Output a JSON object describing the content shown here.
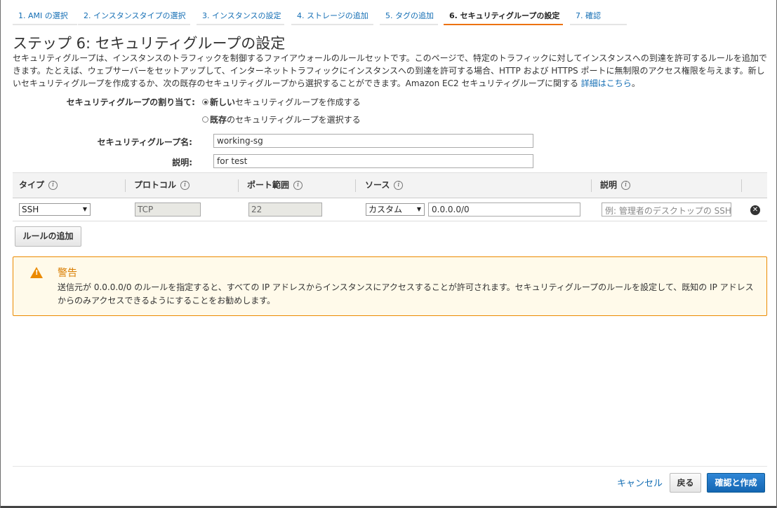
{
  "tabs": [
    {
      "label": "1. AMI の選択"
    },
    {
      "label": "2. インスタンスタイプの選択"
    },
    {
      "label": "3. インスタンスの設定"
    },
    {
      "label": "4. ストレージの追加"
    },
    {
      "label": "5. タグの追加"
    },
    {
      "label": "6. セキュリティグループの設定"
    },
    {
      "label": "7. 確認"
    }
  ],
  "active_tab": 5,
  "page": {
    "title": "ステップ 6: セキュリティグループの設定",
    "intro": "セキュリティグループは、インスタンスのトラフィックを制御するファイアウォールのルールセットです。このページで、特定のトラフィックに対してインスタンスへの到達を許可するルールを追加できます。たとえば、ウェブサーバーをセットアップして、インターネットトラフィックにインスタンスへの到達を許可する場合、HTTP および HTTPS ポートに無制限のアクセス権限を与えます。新しいセキュリティグループを作成するか、次の既存のセキュリティグループから選択することができます。Amazon EC2 セキュリティグループに関する",
    "intro_link": "詳細はこちら",
    "intro_end": "。"
  },
  "assign": {
    "label": "セキュリティグループの割り当て:",
    "option_new_bold": "新しい",
    "option_new_rest": "セキュリティグループを作成する",
    "option_existing_bold": "既存",
    "option_existing_rest": "のセキュリティグループを選択する",
    "selected": "new"
  },
  "group_name": {
    "label": "セキュリティグループ名:",
    "value": "working-sg"
  },
  "description": {
    "label": "説明:",
    "value": "for test"
  },
  "table": {
    "headers": {
      "type": "タイプ",
      "protocol": "プロトコル",
      "port": "ポート範囲",
      "source": "ソース",
      "desc": "説明"
    },
    "info_glyph": "i",
    "rows": [
      {
        "type": "SSH",
        "protocol": "TCP",
        "port": "22",
        "source_type": "カスタム",
        "source_value": "0.0.0.0/0",
        "desc_placeholder": "例: 管理者のデスクトップの SSH"
      }
    ]
  },
  "add_rule_label": "ルールの追加",
  "warning": {
    "title": "警告",
    "text": "送信元が 0.0.0.0/0 のルールを指定すると、すべての IP アドレスからインスタンスにアクセスすることが許可されます。セキュリティグループのルールを設定して、既知の IP アドレスからのみアクセスできるようにすることをお勧めします。",
    "icon": "warning-triangle-icon",
    "color": "#eb8a00"
  },
  "footer": {
    "cancel": "キャンセル",
    "back": "戻る",
    "launch": "確認と作成"
  },
  "colors": {
    "link": "#146eb4",
    "active_tab_underline": "#ec7211",
    "primary_button": "#1466b3"
  }
}
